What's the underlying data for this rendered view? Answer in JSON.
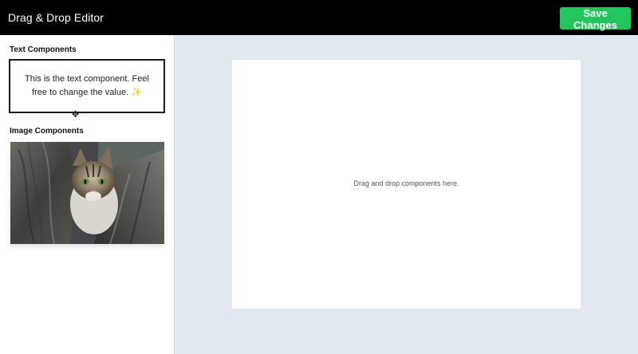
{
  "header": {
    "title": "Drag & Drop Editor",
    "save_label": "Save Changes"
  },
  "sidebar": {
    "text_section_title": "Text Components",
    "text_component": "This is the text component. Feel free to change the value. ✨",
    "image_section_title": "Image Components",
    "image_component": "cat-in-tree-photo"
  },
  "canvas": {
    "placeholder": "Drag and drop components here."
  },
  "colors": {
    "header_bg": "#000000",
    "accent_green": "#22c55e",
    "workspace_bg": "#e2e8f0"
  },
  "icons": [
    "move-cursor-icon"
  ]
}
